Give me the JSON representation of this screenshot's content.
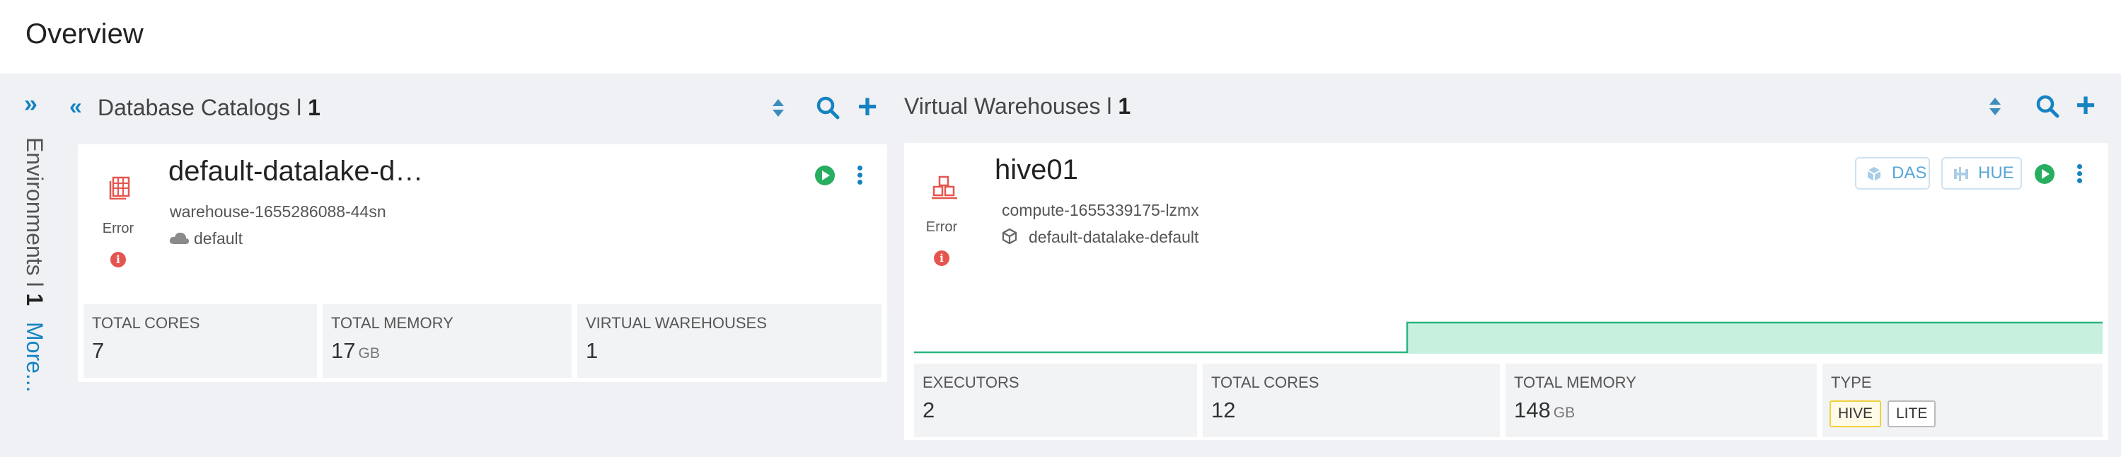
{
  "page": {
    "title": "Overview"
  },
  "rail": {
    "environments_label": "Environments l ",
    "environments_count": "1",
    "more_label": "More..."
  },
  "catalogs": {
    "header_label": "Database Catalogs l ",
    "header_count": "1",
    "card": {
      "title": "default-datalake-d…",
      "warehouse_id": "warehouse-1655286088-44sn",
      "environment": "default",
      "status": "Error",
      "stats": [
        {
          "label": "TOTAL CORES",
          "value": "7",
          "unit": ""
        },
        {
          "label": "TOTAL MEMORY",
          "value": "17",
          "unit": "GB"
        },
        {
          "label": "VIRTUAL WAREHOUSES",
          "value": "1",
          "unit": ""
        }
      ]
    }
  },
  "warehouses": {
    "header_label": "Virtual Warehouses l ",
    "header_count": "1",
    "card": {
      "title": "hive01",
      "compute_id": "compute-1655339175-lzmx",
      "catalog": "default-datalake-default",
      "status": "Error",
      "das_label": "DAS",
      "hue_label": "HUE",
      "stats": [
        {
          "label": "EXECUTORS",
          "value": "2",
          "unit": ""
        },
        {
          "label": "TOTAL CORES",
          "value": "12",
          "unit": ""
        },
        {
          "label": "TOTAL MEMORY",
          "value": "148",
          "unit": "GB"
        },
        {
          "label": "TYPE",
          "value": "",
          "unit": ""
        }
      ],
      "type_badges": [
        "HIVE",
        "LITE"
      ],
      "activity_chart": {
        "type": "step",
        "levels": [
          0,
          1
        ],
        "step_fraction": 0.415
      }
    }
  },
  "colors": {
    "accent": "#1583c2",
    "error": "#e5554f",
    "running": "#27ae60",
    "chart_fill": "#c8f0df",
    "chart_line": "#2bb57f"
  }
}
